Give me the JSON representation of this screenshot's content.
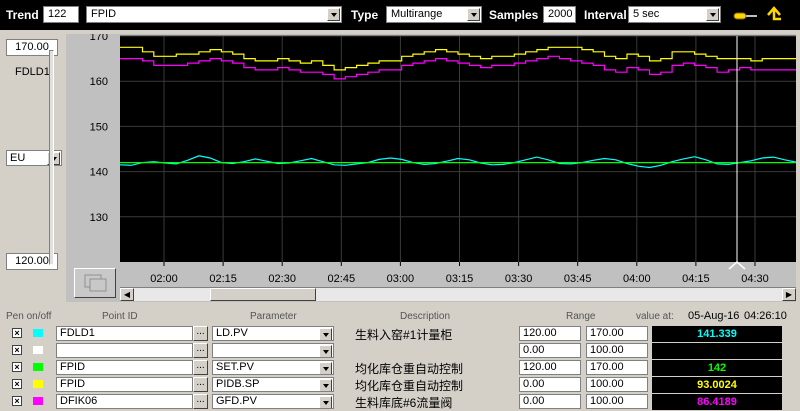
{
  "toolbar": {
    "trend_label": "Trend",
    "trend_number": "122",
    "trend_name": "FPID",
    "type_label": "Type",
    "type_value": "Multirange",
    "samples_label": "Samples",
    "samples_value": "2000",
    "interval_label": "Interval",
    "interval_value": "5 sec"
  },
  "left_panel": {
    "range_high": "170.00",
    "point_name": "FDLD1",
    "units_mode": "EU",
    "range_low": "120.00"
  },
  "chart_data": {
    "type": "line",
    "y_ticks": [
      "170",
      "160",
      "150",
      "140",
      "130"
    ],
    "ylim": [
      120,
      170
    ],
    "x_ticks": [
      "02:00",
      "02:15",
      "02:30",
      "02:45",
      "03:00",
      "03:15",
      "03:30",
      "03:45",
      "04:00",
      "04:15",
      "04:30"
    ],
    "colors": {
      "yellow": "#ffff00",
      "magenta": "#ff00ff",
      "cyan": "#00ffff",
      "green": "#00ff00",
      "background": "#000000"
    },
    "series": [
      {
        "color": "#ffff00",
        "values": [
          167.5,
          167.5,
          166.5,
          165.5,
          165.5,
          166,
          166,
          166.5,
          167,
          166.5,
          166,
          165,
          164.5,
          164.5,
          165,
          164.5,
          164,
          164.5,
          163.5,
          162.5,
          163,
          163.5,
          164,
          164.5,
          164.5,
          165.5,
          166,
          166.5,
          167,
          166.5,
          166,
          165.5,
          165,
          165.5,
          165.5,
          166,
          166.5,
          167,
          167.5,
          167.5,
          167.5,
          167,
          166.5,
          165.5,
          165,
          166,
          165.5,
          164.5,
          165,
          166.5,
          166.5,
          166,
          165.5,
          165,
          165,
          165,
          164.5,
          165,
          165,
          165,
          165
        ]
      },
      {
        "color": "#ff00ff",
        "values": [
          165,
          165,
          164.5,
          163.5,
          163.5,
          163.5,
          164,
          164.5,
          165,
          164.5,
          164,
          163,
          162.5,
          162.5,
          163,
          162.5,
          162,
          162,
          161.5,
          160.5,
          161,
          161.5,
          162,
          162.5,
          162.5,
          163.5,
          164,
          164.5,
          165,
          164.5,
          164,
          163.5,
          163,
          163.5,
          163.5,
          164,
          164.5,
          165,
          165.5,
          165,
          164.5,
          164,
          163.5,
          162.5,
          162,
          163,
          162.5,
          161.5,
          162,
          163.5,
          164,
          163.5,
          163,
          162,
          162.5,
          163,
          162.5,
          162.5,
          162.5,
          162.5,
          162.5
        ]
      },
      {
        "color": "#00ffff",
        "values": [
          141.5,
          141.4,
          142,
          142.2,
          141.9,
          141.7,
          142.5,
          143.5,
          143,
          142,
          141.8,
          142.2,
          142.8,
          142.3,
          141.8,
          141.9,
          142.4,
          142.9,
          142.2,
          141.5,
          141.4,
          141.7,
          142,
          142.7,
          143,
          142.7,
          142,
          141.6,
          141.8,
          142.3,
          142.9,
          142.6,
          141.9,
          141.5,
          141.6,
          142,
          142.6,
          143.2,
          142.6,
          141.8,
          141.7,
          142,
          142.5,
          142.9,
          142.6,
          141.8,
          141.2,
          140.9,
          141.4,
          142.2,
          142.8,
          143.3,
          142.6,
          141.7,
          141.6,
          142,
          142.4,
          143,
          143.2,
          142.6,
          142.1
        ]
      },
      {
        "color": "#00ff00",
        "values": [
          142,
          142
        ]
      }
    ]
  },
  "table": {
    "headers": {
      "pen": "Pen on/off",
      "point_id": "Point ID",
      "parameter": "Parameter",
      "description": "Description",
      "range": "Range",
      "value_at": "value at:",
      "date": "05-Aug-16",
      "time": "04:26:10"
    },
    "check_mark": "×",
    "dots": "...",
    "rows": [
      {
        "swatch": "#00ffff",
        "point": "FDLD1",
        "param": "LD.PV",
        "desc": "生料入窑#1计量柜",
        "lo": "120.00",
        "hi": "170.00",
        "value": "141.339",
        "value_color": "#00ffff"
      },
      {
        "swatch": "#ffffff",
        "point": "",
        "param": "",
        "desc": "",
        "lo": "0.00",
        "hi": "100.00",
        "value": "",
        "value_color": "#ffffff"
      },
      {
        "swatch": "#00ff00",
        "point": "FPID",
        "param": "SET.PV",
        "desc": "均化库仓重自动控制",
        "lo": "120.00",
        "hi": "170.00",
        "value": "142",
        "value_color": "#00ff00"
      },
      {
        "swatch": "#ffff00",
        "point": "FPID",
        "param": "PIDB.SP",
        "desc": "均化库仓重自动控制",
        "lo": "0.00",
        "hi": "100.00",
        "value": "93.0024",
        "value_color": "#ffff00"
      },
      {
        "swatch": "#ff00ff",
        "point": "DFIK06",
        "param": "GFD.PV",
        "desc": "生料库底#6流量阀",
        "lo": "0.00",
        "hi": "100.00",
        "value": "86.4189",
        "value_color": "#ff00ff"
      }
    ]
  }
}
